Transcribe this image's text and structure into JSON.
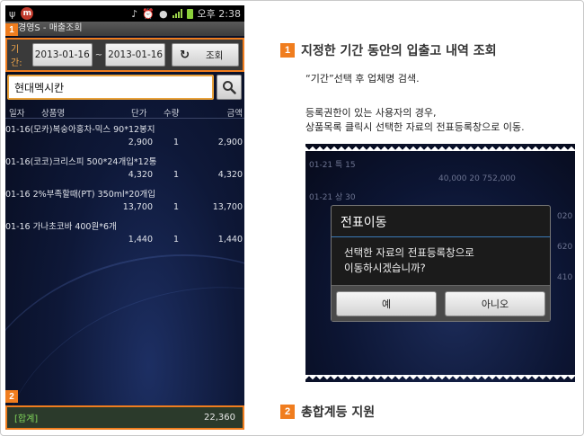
{
  "status_bar": {
    "badge": "m",
    "carrier_time": "오후 2:38"
  },
  "app": {
    "title": "경영S - 매출조회"
  },
  "markers": {
    "one": "1",
    "two": "2"
  },
  "filter": {
    "period_label": "기간:",
    "date_from": "2013-01-16",
    "separator": "~",
    "date_to": "2013-01-16",
    "query_label": "조회"
  },
  "search": {
    "value": "현대멕시칸"
  },
  "table": {
    "headers": {
      "date": "일자",
      "product": "상품명",
      "price": "단가",
      "qty": "수량",
      "amount": "금액"
    },
    "rows": [
      {
        "name": "01-16(모카)복숭아홍차-믹스 90*12봉지",
        "price": "2,900",
        "qty": "1",
        "amount": "2,900"
      },
      {
        "name": "01-16(코코)크리스피 500*24개입*12통",
        "price": "4,320",
        "qty": "1",
        "amount": "4,320"
      },
      {
        "name": "01-16 2%부족할때(PT) 350ml*20개입",
        "price": "13,700",
        "qty": "1",
        "amount": "13,700"
      },
      {
        "name": "01-16 가나초코바 400원*6개",
        "price": "1,440",
        "qty": "1",
        "amount": "1,440"
      }
    ]
  },
  "total": {
    "label": "[합계]",
    "value": "22,360"
  },
  "annotations": {
    "one": {
      "num": "1",
      "title": "지정한 기간 동안의 입출고 내역 조회",
      "line1": "“기간”선택 후 업체명 검색.",
      "line2": "등록권한이 있는 사용자의 경우,",
      "line3": "상품목록 클릭시 선택한 자료의 전표등록창으로 이동."
    },
    "two": {
      "num": "2",
      "title": "총합계등 지원"
    }
  },
  "preview": {
    "bg_rows": {
      "r1_date": "01-21 특 15",
      "r1_vals": "40,000        20        752,000",
      "r2_date": "01-21 상 30",
      "r2_val": "020",
      "r3_val": "620",
      "r4_val": "410"
    },
    "dialog": {
      "title": "전표이동",
      "message_line1": "선택한 자료의 전표등록창으로",
      "message_line2": "이동하시겠습니까?",
      "yes": "예",
      "no": "아니오"
    }
  },
  "colors": {
    "accent": "#f07d1e",
    "total_label": "#7fd45a"
  }
}
